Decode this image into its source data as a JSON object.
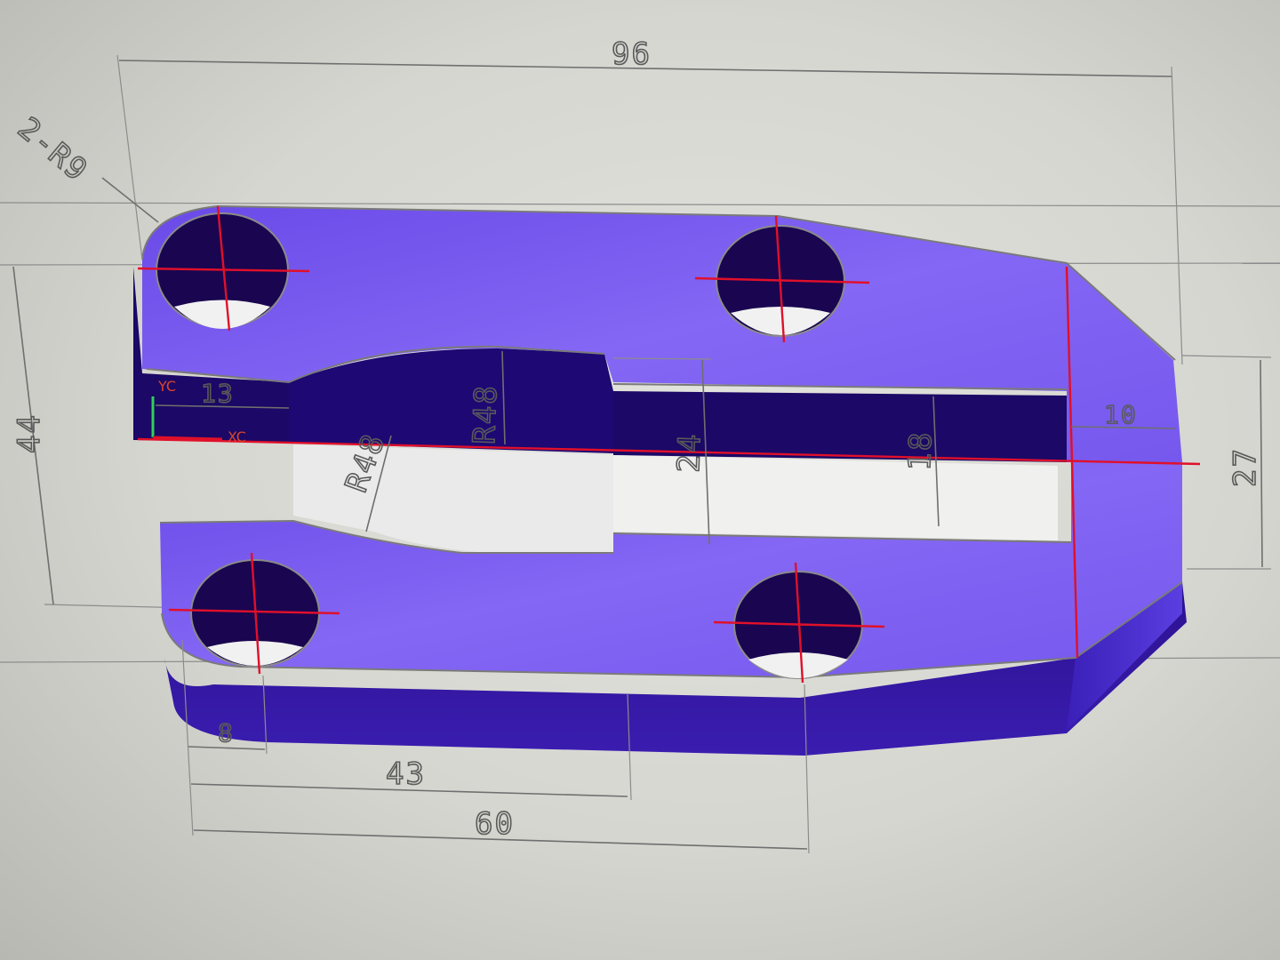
{
  "dimensions": {
    "overall_width": "96",
    "corner_radius": "2-R9",
    "overall_height": "44",
    "slot_left_len": "13",
    "arc_radius_top": "R48",
    "arc_radius_bottom": "R48",
    "slot_width": "24",
    "inner_slot": "18",
    "right_offset": "10",
    "right_height": "27",
    "hole_offset": "8",
    "mid_len": "43",
    "hole_spacing": "60"
  },
  "axes": {
    "x": "XC",
    "y": "YC"
  },
  "colors": {
    "part_face": "#7b5cf0",
    "part_side": "#2a0f8f",
    "part_dark": "#1a0550",
    "center_line": "#e0102a",
    "dim_line": "#6f6f6f"
  }
}
